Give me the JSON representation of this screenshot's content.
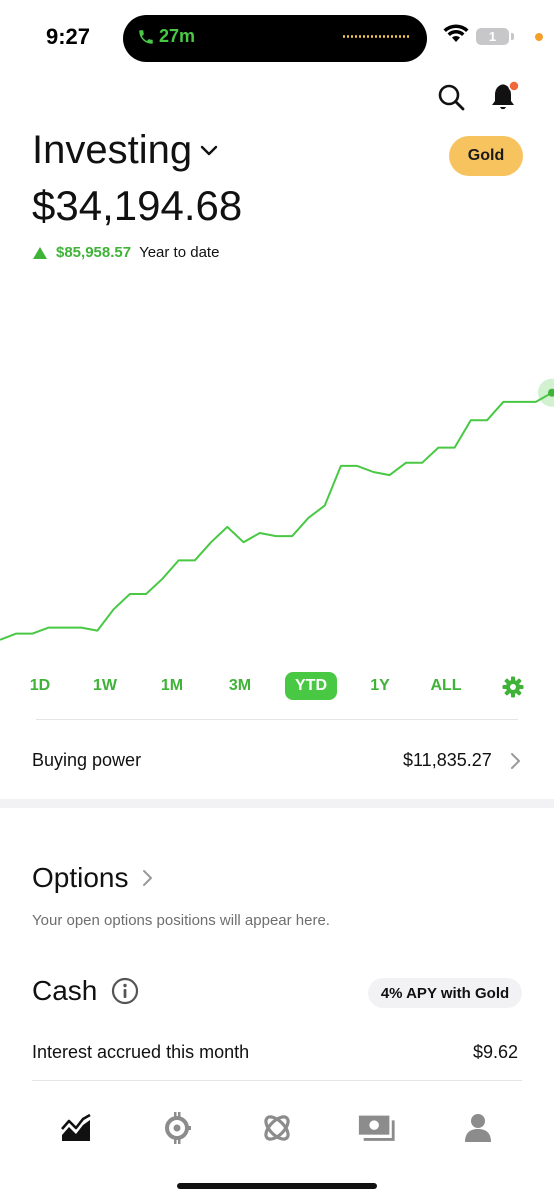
{
  "status_bar": {
    "time": "9:27",
    "call_duration": "27m",
    "battery_level": "1"
  },
  "header": {
    "account_title": "Investing",
    "gold_button": "Gold"
  },
  "portfolio": {
    "value": "$34,194.68",
    "gain_amount": "$85,958.57",
    "gain_period": "Year to date"
  },
  "colors": {
    "accent_green": "#49c844",
    "gold": "#f7c35f",
    "notification": "#f0683a"
  },
  "chart_data": {
    "type": "line",
    "series_color": "#49c844",
    "points": [
      0.05,
      0.07,
      0.07,
      0.09,
      0.09,
      0.09,
      0.08,
      0.15,
      0.2,
      0.2,
      0.25,
      0.31,
      0.31,
      0.37,
      0.42,
      0.37,
      0.4,
      0.39,
      0.39,
      0.45,
      0.49,
      0.62,
      0.62,
      0.6,
      0.59,
      0.63,
      0.63,
      0.68,
      0.68,
      0.77,
      0.77,
      0.83,
      0.83,
      0.83,
      0.86
    ],
    "range": "YTD"
  },
  "ranges": {
    "items": [
      "1D",
      "1W",
      "1M",
      "3M",
      "YTD",
      "1Y",
      "ALL"
    ],
    "active": "YTD"
  },
  "buying_power": {
    "label": "Buying power",
    "value": "$11,835.27"
  },
  "options": {
    "title": "Options",
    "subtitle": "Your open options positions will appear here."
  },
  "cash": {
    "title": "Cash",
    "apy_badge": "4% APY with Gold",
    "interest_label": "Interest accrued this month",
    "interest_value": "$9.62"
  },
  "bottom_nav": {
    "icons": [
      "chart-icon",
      "crypto-icon",
      "browse-icon",
      "cash-icon",
      "account-icon"
    ]
  }
}
